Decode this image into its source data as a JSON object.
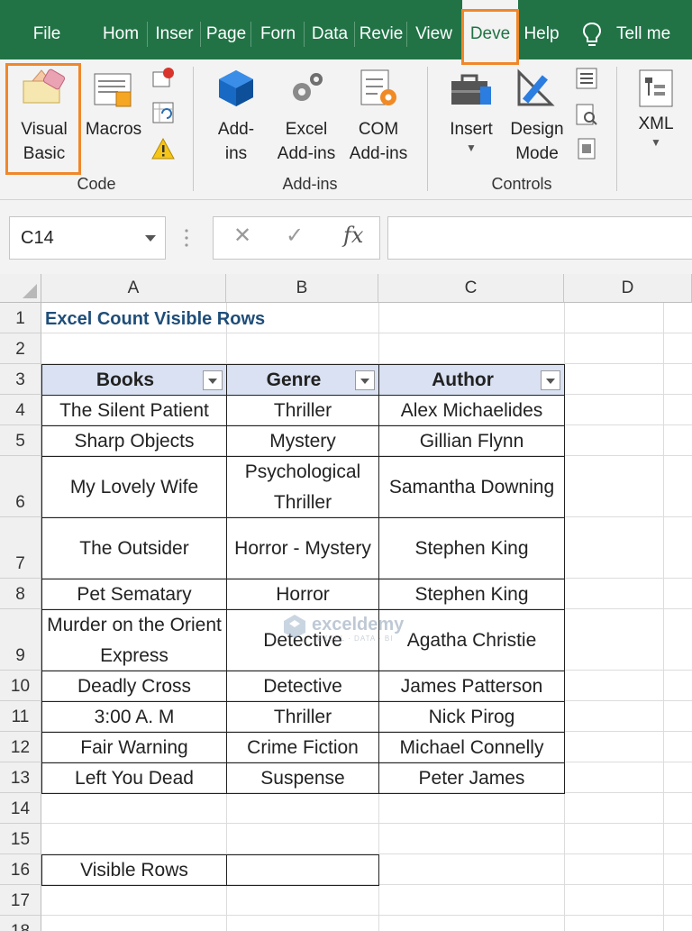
{
  "tabs": [
    {
      "label": "File",
      "active": false
    },
    {
      "label": "Hom",
      "active": false
    },
    {
      "label": "Inser",
      "active": false
    },
    {
      "label": "Page",
      "active": false
    },
    {
      "label": "Forn",
      "active": false
    },
    {
      "label": "Data",
      "active": false
    },
    {
      "label": "Revie",
      "active": false
    },
    {
      "label": "View",
      "active": false
    },
    {
      "label": "Deve",
      "active": true
    },
    {
      "label": "Help",
      "active": false
    }
  ],
  "tell_me": "Tell me",
  "ribbon": {
    "code": {
      "visual_basic": "Visual\nBasic",
      "macros": "Macros",
      "group_label": "Code"
    },
    "addins": {
      "addins": "Add-\nins",
      "excel_addins": "Excel\nAdd-ins",
      "com_addins": "COM\nAdd-ins",
      "group_label": "Add-ins"
    },
    "controls": {
      "insert": "Insert",
      "design_mode": "Design\nMode",
      "group_label": "Controls"
    },
    "xml": {
      "label": "XML"
    }
  },
  "formula_bar": {
    "name_box": "C14",
    "cancel_symbol": "✕",
    "enter_symbol": "✓",
    "fx_symbol": "fx",
    "formula": ""
  },
  "columns": [
    "A",
    "B",
    "C",
    "D"
  ],
  "rows": [
    "1",
    "2",
    "3",
    "4",
    "5",
    "6",
    "7",
    "8",
    "9",
    "10",
    "11",
    "12",
    "13",
    "14",
    "15",
    "16",
    "17",
    "18"
  ],
  "sheet": {
    "title": "Excel Count Visible Rows",
    "headers": [
      "Books",
      "Genre",
      "Author"
    ],
    "data": [
      [
        "The Silent Patient",
        "Thriller",
        "Alex Michaelides"
      ],
      [
        "Sharp Objects",
        "Mystery",
        "Gillian Flynn"
      ],
      [
        "My Lovely Wife",
        "Psychological Thriller",
        "Samantha Downing"
      ],
      [
        "The Outsider",
        "Horror - Mystery",
        "Stephen King"
      ],
      [
        "Pet Sematary",
        "Horror",
        "Stephen King"
      ],
      [
        "Murder on the Orient Express",
        "Detective",
        "Agatha Christie"
      ],
      [
        "Deadly Cross",
        "Detective",
        "James Patterson"
      ],
      [
        "3:00 A. M",
        "Thriller",
        "Nick Pirog"
      ],
      [
        "Fair Warning",
        "Crime Fiction",
        "Michael Connelly"
      ],
      [
        "Left You Dead",
        "Suspense",
        "Peter James"
      ]
    ],
    "visible_rows_label": "Visible Rows",
    "visible_rows_value": ""
  },
  "watermark": {
    "name": "exceldemy",
    "tagline": "EXCEL · DATA · BI"
  },
  "colors": {
    "ribbon_green": "#217346",
    "highlight_orange": "#f0872a",
    "table_header": "#d9e1f2",
    "title_blue": "#1f4e79"
  }
}
